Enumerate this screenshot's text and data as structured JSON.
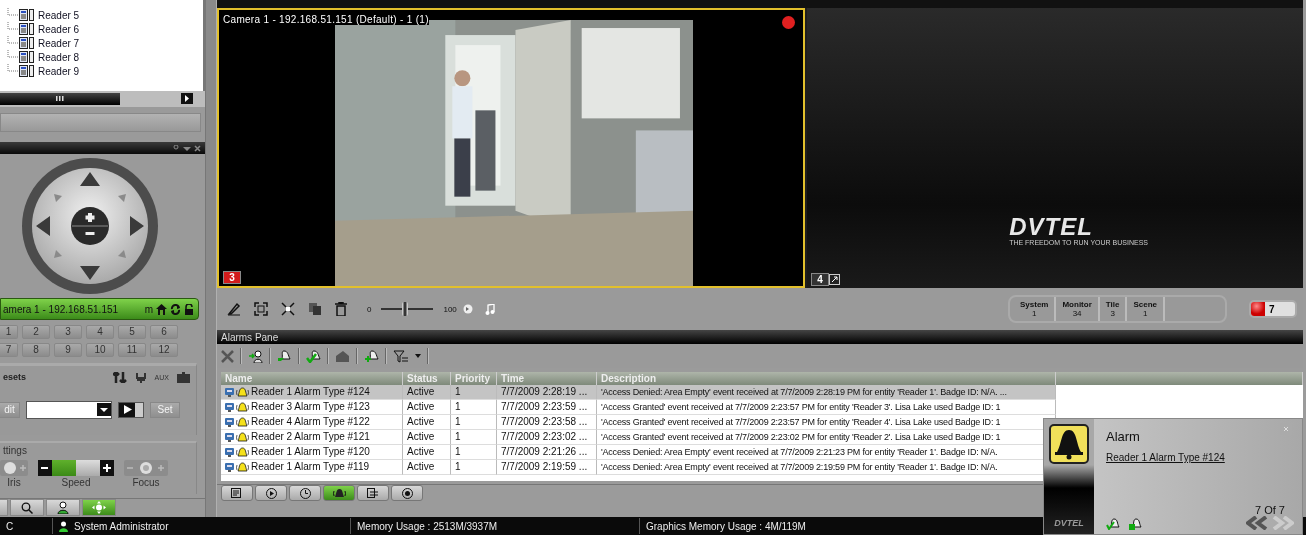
{
  "tree": {
    "items": [
      {
        "label": "Reader 5"
      },
      {
        "label": "Reader 6"
      },
      {
        "label": "Reader 7"
      },
      {
        "label": "Reader 8"
      },
      {
        "label": "Reader 9"
      }
    ]
  },
  "ptz": {
    "camera": "amera 1 - 192.168.51.151",
    "camera_code": "m",
    "presets_row_1": [
      "1",
      "2",
      "3",
      "4",
      "5",
      "6"
    ],
    "presets_row_2": [
      "7",
      "8",
      "9",
      "10",
      "11",
      "12"
    ],
    "presets_title": "esets",
    "aux": "AUX",
    "edit_button": "dit",
    "set_button": "Set",
    "settings_title": "ttings",
    "iris_label": "Iris",
    "speed": {
      "label": "Speed",
      "level": 0.5
    },
    "focus_label": "Focus"
  },
  "left_tabs": [
    {
      "kind": "blank",
      "selected": false
    },
    {
      "kind": "search",
      "selected": false
    },
    {
      "kind": "person",
      "selected": false
    },
    {
      "kind": "move",
      "selected": true
    }
  ],
  "tiles": [
    {
      "kind": "video",
      "title": "Camera 1 - 192.168.51.151 (Default) - 1 (1)",
      "number": "3",
      "selected": true,
      "recording": true
    },
    {
      "kind": "logo",
      "number": "4",
      "selected": false,
      "recording": false,
      "logo": "DVTEL",
      "tagline": "THE FREEDOM TO RUN YOUR BUSINESS"
    }
  ],
  "volume": {
    "min": "0",
    "max": "100",
    "level": 0.45
  },
  "status_box": [
    {
      "label": "System",
      "value": "1"
    },
    {
      "label": "Monitor",
      "value": "34"
    },
    {
      "label": "Tile",
      "value": "3"
    },
    {
      "label": "Scene",
      "value": "1"
    }
  ],
  "alarm_count": "7",
  "alarms_pane": {
    "title": "Alarms Pane",
    "columns": [
      "Name",
      "Status",
      "Priority",
      "Time",
      "Description"
    ],
    "rows": [
      {
        "name": "Reader 1 Alarm Type #124",
        "status": "Active",
        "priority": "1",
        "time": "7/7/2009 2:28:19 ...",
        "description": "'Access Denied: Area Empty' event received at 7/7/2009 2:28:19 PM for entity 'Reader 1'. Badge ID: N/A. ...",
        "selected": true
      },
      {
        "name": "Reader 3 Alarm Type #123",
        "status": "Active",
        "priority": "1",
        "time": "7/7/2009 2:23:59 ...",
        "description": "'Access Granted' event received at 7/7/2009 2:23:57 PM for entity 'Reader 3'. Lisa Lake used Badge ID: 1",
        "selected": false
      },
      {
        "name": "Reader 4 Alarm Type #122",
        "status": "Active",
        "priority": "1",
        "time": "7/7/2009 2:23:58 ...",
        "description": "'Access Granted' event received at 7/7/2009 2:23:57 PM for entity 'Reader 4'. Lisa Lake used Badge ID: 1",
        "selected": false
      },
      {
        "name": "Reader 2 Alarm Type #121",
        "status": "Active",
        "priority": "1",
        "time": "7/7/2009 2:23:02 ...",
        "description": "'Access Granted' event received at 7/7/2009 2:23:02 PM for entity 'Reader 2'. Lisa Lake used Badge ID: 1",
        "selected": false
      },
      {
        "name": "Reader 1 Alarm Type #120",
        "status": "Active",
        "priority": "1",
        "time": "7/7/2009 2:21:26 ...",
        "description": "'Access Denied: Area Empty' event received at 7/7/2009 2:21:23 PM for entity 'Reader 1'. Badge ID: N/A.",
        "selected": false
      },
      {
        "name": "Reader 1 Alarm Type #119",
        "status": "Active",
        "priority": "1",
        "time": "7/7/2009 2:19:59 ...",
        "description": "'Access Denied: Area Empty' event received at 7/7/2009 2:19:59 PM for entity 'Reader 1'. Badge ID: N/A.",
        "selected": false
      }
    ]
  },
  "bottom_tabs": [
    {
      "kind": "report",
      "selected": false
    },
    {
      "kind": "play",
      "selected": false
    },
    {
      "kind": "clock",
      "selected": false
    },
    {
      "kind": "alarm",
      "selected": true
    },
    {
      "kind": "list",
      "selected": false
    },
    {
      "kind": "badge",
      "selected": false
    }
  ],
  "status_bar": {
    "left": "C",
    "user": "System Administrator",
    "memory": "Memory Usage : 2513M/3937M",
    "graphics_memory": "Graphics Memory Usage : 4M/119M"
  },
  "popup": {
    "title": "Alarm",
    "link": "Reader 1 Alarm Type #124",
    "counter": "7 Of 7",
    "logo": "DVTEL"
  }
}
